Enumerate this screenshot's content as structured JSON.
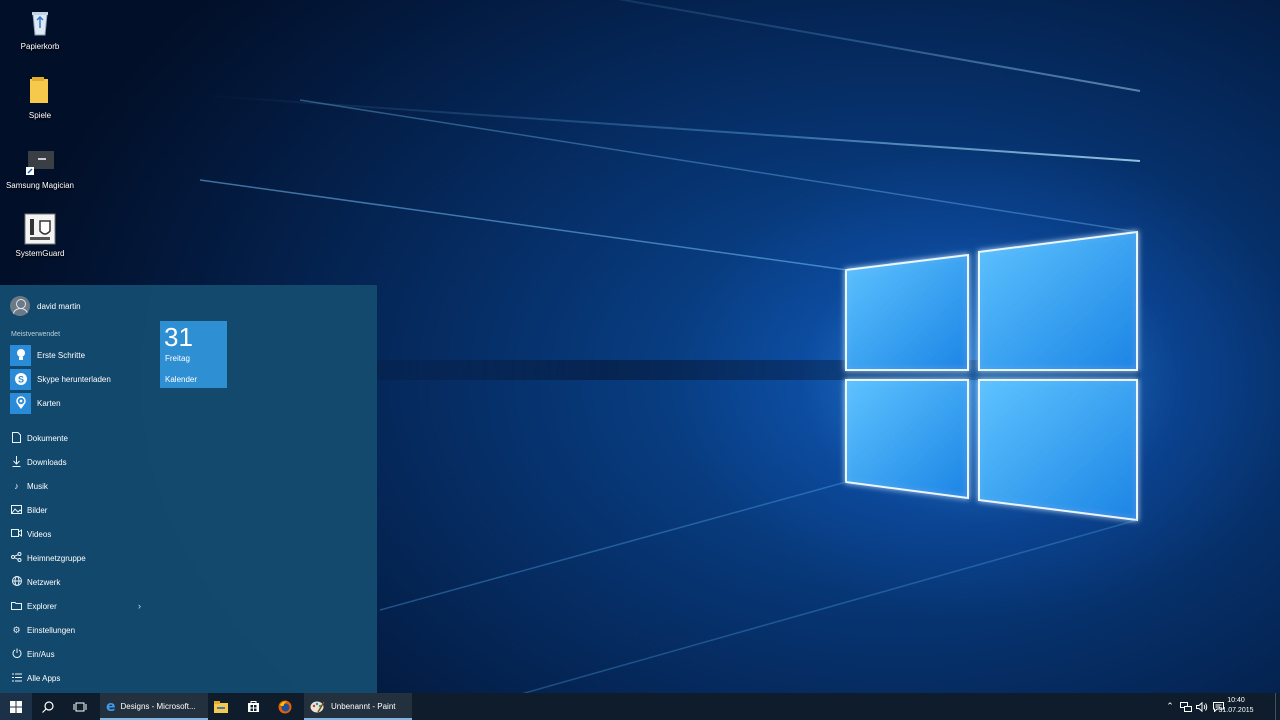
{
  "desktop": {
    "icons": [
      {
        "label": "Papierkorb",
        "icon": "recycle-bin-icon"
      },
      {
        "label": "Spiele",
        "icon": "folder-icon"
      },
      {
        "label": "Samsung Magician",
        "icon": "samsung-magician-icon"
      },
      {
        "label": "SystemGuard",
        "icon": "systemguard-icon"
      }
    ]
  },
  "start_menu": {
    "user_name": "david martin",
    "most_used_label": "Meistverwendet",
    "most_used": [
      {
        "label": "Erste Schritte",
        "icon": "lightbulb-icon"
      },
      {
        "label": "Skype herunterladen",
        "icon": "skype-icon"
      },
      {
        "label": "Karten",
        "icon": "maps-icon"
      }
    ],
    "places": [
      {
        "label": "Dokumente",
        "icon": "document-icon"
      },
      {
        "label": "Downloads",
        "icon": "download-icon"
      },
      {
        "label": "Musik",
        "icon": "music-icon"
      },
      {
        "label": "Bilder",
        "icon": "pictures-icon"
      },
      {
        "label": "Videos",
        "icon": "video-icon"
      },
      {
        "label": "Heimnetzgruppe",
        "icon": "homegroup-icon"
      },
      {
        "label": "Netzwerk",
        "icon": "network-icon"
      },
      {
        "label": "Explorer",
        "icon": "explorer-icon",
        "has_submenu": true
      },
      {
        "label": "Einstellungen",
        "icon": "gear-icon"
      },
      {
        "label": "Ein/Aus",
        "icon": "power-icon"
      },
      {
        "label": "Alle Apps",
        "icon": "all-apps-icon"
      }
    ],
    "calendar_tile": {
      "date_number": "31",
      "weekday": "Freitag",
      "app_name": "Kalender"
    }
  },
  "taskbar": {
    "apps": [
      {
        "label": "Designs - Microsoft...",
        "icon": "edge-icon"
      },
      {
        "label": "Unbenannt - Paint",
        "icon": "paint-icon"
      }
    ],
    "pinned": [
      "file-explorer-icon",
      "store-icon",
      "firefox-icon"
    ],
    "clock_time": "10:40",
    "clock_date": "31.07.2015"
  },
  "colors": {
    "start_menu_bg": "#134b6e",
    "tile_accent": "#2f8fd3",
    "taskbar_bg": "#0e1c2b"
  }
}
